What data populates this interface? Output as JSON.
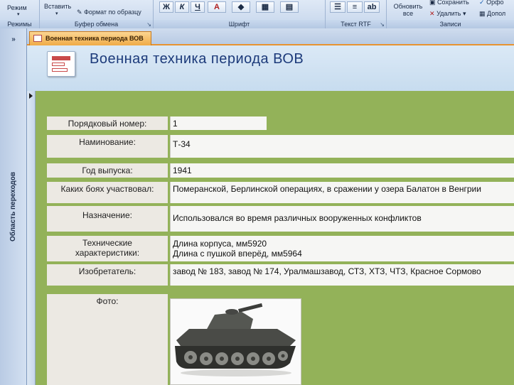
{
  "ribbon": {
    "mode_label": "Режим",
    "paste_label": "Вставить",
    "format_painter_label": "Формат по образцу",
    "refresh_label": "Обновить все",
    "save_label": "Сохранить",
    "delete_label": "Удалить",
    "spelling_label": "Орфо",
    "more_label": "Допол",
    "groups": {
      "views": "Режимы",
      "clipboard": "Буфер обмена",
      "font": "Шрифт",
      "rtf": "Текст RTF",
      "records": "Записи"
    },
    "font_buttons": {
      "bold": "Ж",
      "italic": "К",
      "underline": "Ч",
      "font_color": "А"
    }
  },
  "nav_pane": {
    "chevron": "»",
    "label": "Область переходов"
  },
  "document_tab": {
    "label": "Военная техника периода ВОВ"
  },
  "form": {
    "title": "Военная техника периода ВОВ",
    "fields": {
      "number_label": "Порядковый номер:",
      "number_value": "1",
      "name_label": "Наминование:",
      "name_value": "Т-34",
      "year_label": "Год выпуска:",
      "year_value": "1941",
      "battles_label": "Каких боях участвовал:",
      "battles_value": "Померанской, Берлинской операциях, в сражении у озера Балатон в Венгрии",
      "purpose_label": "Назначение:",
      "purpose_value": "Использовался во время различных вооруженных конфликтов",
      "specs_label_line1": "Технические",
      "specs_label_line2": "характеристики:",
      "specs_value_line1": "Длина корпуса, мм5920",
      "specs_value_line2": "Длина с пушкой вперёд, мм5964",
      "inventor_label": "Изобретатель:",
      "inventor_value": "завод № 183, завод № 174, Уралмашзавод, СТЗ, ХТЗ, ЧТЗ, Красное Сормово",
      "photo_label": "Фото:"
    }
  }
}
